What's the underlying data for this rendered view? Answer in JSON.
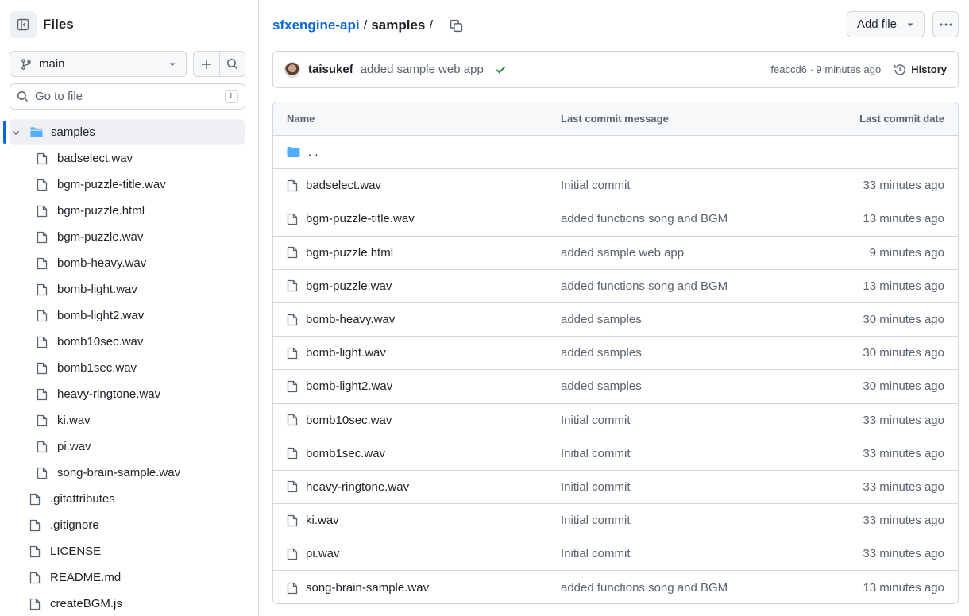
{
  "sidebar": {
    "title": "Files",
    "branch": "main",
    "search_placeholder": "Go to file",
    "search_shortcut": "t",
    "folder": "samples",
    "folder_files": [
      "badselect.wav",
      "bgm-puzzle-title.wav",
      "bgm-puzzle.html",
      "bgm-puzzle.wav",
      "bomb-heavy.wav",
      "bomb-light.wav",
      "bomb-light2.wav",
      "bomb10sec.wav",
      "bomb1sec.wav",
      "heavy-ringtone.wav",
      "ki.wav",
      "pi.wav",
      "song-brain-sample.wav"
    ],
    "root_files": [
      ".gitattributes",
      ".gitignore",
      "LICENSE",
      "README.md",
      "createBGM.js"
    ]
  },
  "breadcrumb": {
    "repo": "sfxengine-api",
    "separator": "/",
    "current": "samples",
    "trailing": "/"
  },
  "actions": {
    "add_file": "Add file"
  },
  "latest_commit": {
    "author": "taisukef",
    "message": "added sample web app",
    "hash": "feaccd6",
    "time": "9 minutes ago",
    "dot": "·",
    "history_label": "History"
  },
  "table": {
    "headers": {
      "name": "Name",
      "message": "Last commit message",
      "date": "Last commit date"
    },
    "parent_dir": ". .",
    "rows": [
      {
        "name": "badselect.wav",
        "message": "Initial commit",
        "date": "33 minutes ago"
      },
      {
        "name": "bgm-puzzle-title.wav",
        "message": "added functions song and BGM",
        "date": "13 minutes ago"
      },
      {
        "name": "bgm-puzzle.html",
        "message": "added sample web app",
        "date": "9 minutes ago"
      },
      {
        "name": "bgm-puzzle.wav",
        "message": "added functions song and BGM",
        "date": "13 minutes ago"
      },
      {
        "name": "bomb-heavy.wav",
        "message": "added samples",
        "date": "30 minutes ago"
      },
      {
        "name": "bomb-light.wav",
        "message": "added samples",
        "date": "30 minutes ago"
      },
      {
        "name": "bomb-light2.wav",
        "message": "added samples",
        "date": "30 minutes ago"
      },
      {
        "name": "bomb10sec.wav",
        "message": "Initial commit",
        "date": "33 minutes ago"
      },
      {
        "name": "bomb1sec.wav",
        "message": "Initial commit",
        "date": "33 minutes ago"
      },
      {
        "name": "heavy-ringtone.wav",
        "message": "Initial commit",
        "date": "33 minutes ago"
      },
      {
        "name": "ki.wav",
        "message": "Initial commit",
        "date": "33 minutes ago"
      },
      {
        "name": "pi.wav",
        "message": "Initial commit",
        "date": "33 minutes ago"
      },
      {
        "name": "song-brain-sample.wav",
        "message": "added functions song and BGM",
        "date": "13 minutes ago"
      }
    ]
  },
  "colors": {
    "link": "#0969da",
    "folder": "#54aeff",
    "success": "#1a7f37",
    "border": "#d0d7de",
    "muted": "#59636e"
  }
}
